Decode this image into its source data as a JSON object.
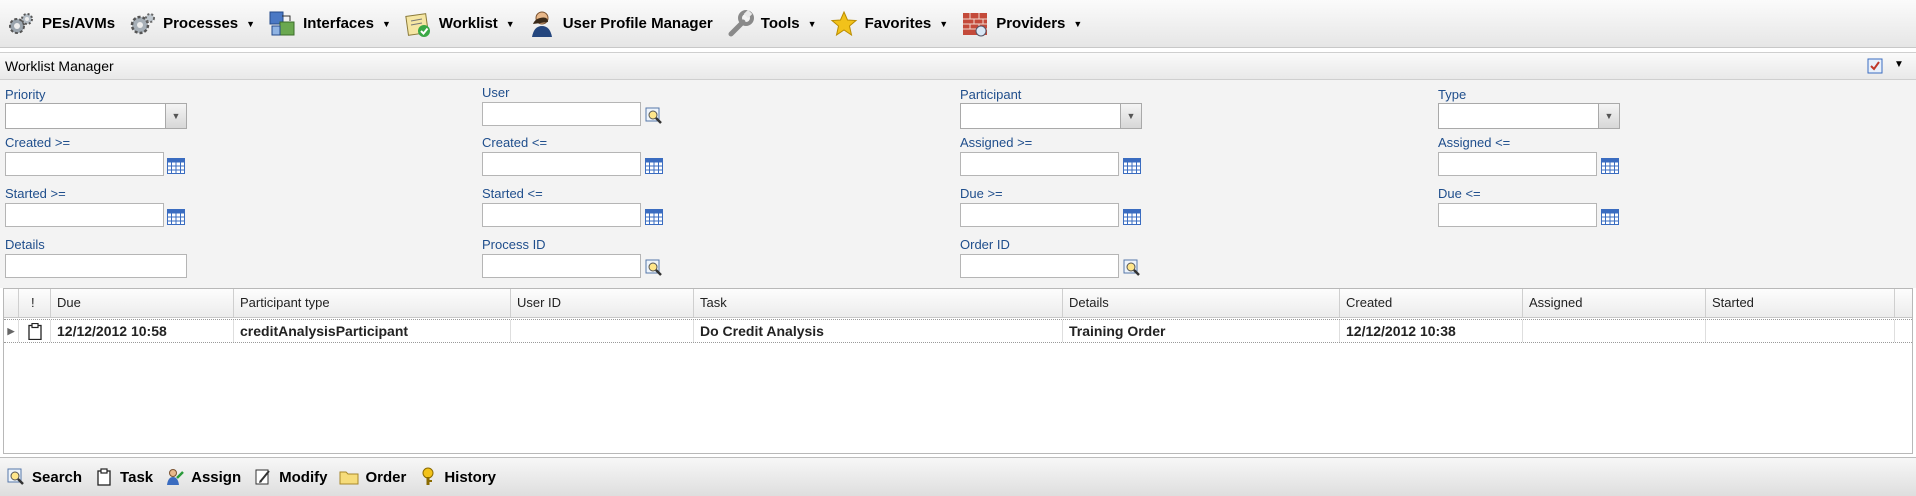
{
  "menubar": {
    "items": [
      {
        "label": "PEs/AVMs",
        "icon": "gears-icon",
        "has_caret": false
      },
      {
        "label": "Processes",
        "icon": "gear-icon",
        "has_caret": true
      },
      {
        "label": "Interfaces",
        "icon": "interfaces-icon",
        "has_caret": true
      },
      {
        "label": "Worklist",
        "icon": "worklist-icon",
        "has_caret": true
      },
      {
        "label": "User Profile Manager",
        "icon": "user-icon",
        "has_caret": false
      },
      {
        "label": "Tools",
        "icon": "wrench-icon",
        "has_caret": true
      },
      {
        "label": "Favorites",
        "icon": "star-icon",
        "has_caret": true
      },
      {
        "label": "Providers",
        "icon": "providers-icon",
        "has_caret": true
      }
    ]
  },
  "panel": {
    "title": "Worklist Manager"
  },
  "filters": {
    "priority": {
      "label": "Priority",
      "value": ""
    },
    "user": {
      "label": "User",
      "value": ""
    },
    "participant": {
      "label": "Participant",
      "value": ""
    },
    "type": {
      "label": "Type",
      "value": ""
    },
    "created_from": {
      "label": "Created >=",
      "value": ""
    },
    "created_to": {
      "label": "Created <=",
      "value": ""
    },
    "assigned_from": {
      "label": "Assigned >=",
      "value": ""
    },
    "assigned_to": {
      "label": "Assigned <=",
      "value": ""
    },
    "started_from": {
      "label": "Started >=",
      "value": ""
    },
    "started_to": {
      "label": "Started <=",
      "value": ""
    },
    "due_from": {
      "label": "Due >=",
      "value": ""
    },
    "due_to": {
      "label": "Due <=",
      "value": ""
    },
    "details": {
      "label": "Details",
      "value": ""
    },
    "process_id": {
      "label": "Process ID",
      "value": ""
    },
    "order_id": {
      "label": "Order ID",
      "value": ""
    }
  },
  "grid": {
    "columns": [
      "!",
      "Due",
      "Participant type",
      "User ID",
      "Task",
      "Details",
      "Created",
      "Assigned",
      "Started"
    ],
    "rows": [
      {
        "due": "12/12/2012 10:58",
        "participant_type": "creditAnalysisParticipant",
        "user_id": "",
        "task": "Do Credit Analysis",
        "details": "Training Order",
        "created": "12/12/2012 10:38",
        "assigned": "",
        "started": ""
      }
    ]
  },
  "toolbar": {
    "items": [
      {
        "label": "Search",
        "icon": "search-icon"
      },
      {
        "label": "Task",
        "icon": "clipboard-icon"
      },
      {
        "label": "Assign",
        "icon": "assign-icon"
      },
      {
        "label": "Modify",
        "icon": "edit-icon"
      },
      {
        "label": "Order",
        "icon": "folder-icon"
      },
      {
        "label": "History",
        "icon": "history-icon"
      }
    ]
  },
  "colors": {
    "label_blue": "#1f4e8c",
    "calendar_blue": "#3a6cc0"
  }
}
